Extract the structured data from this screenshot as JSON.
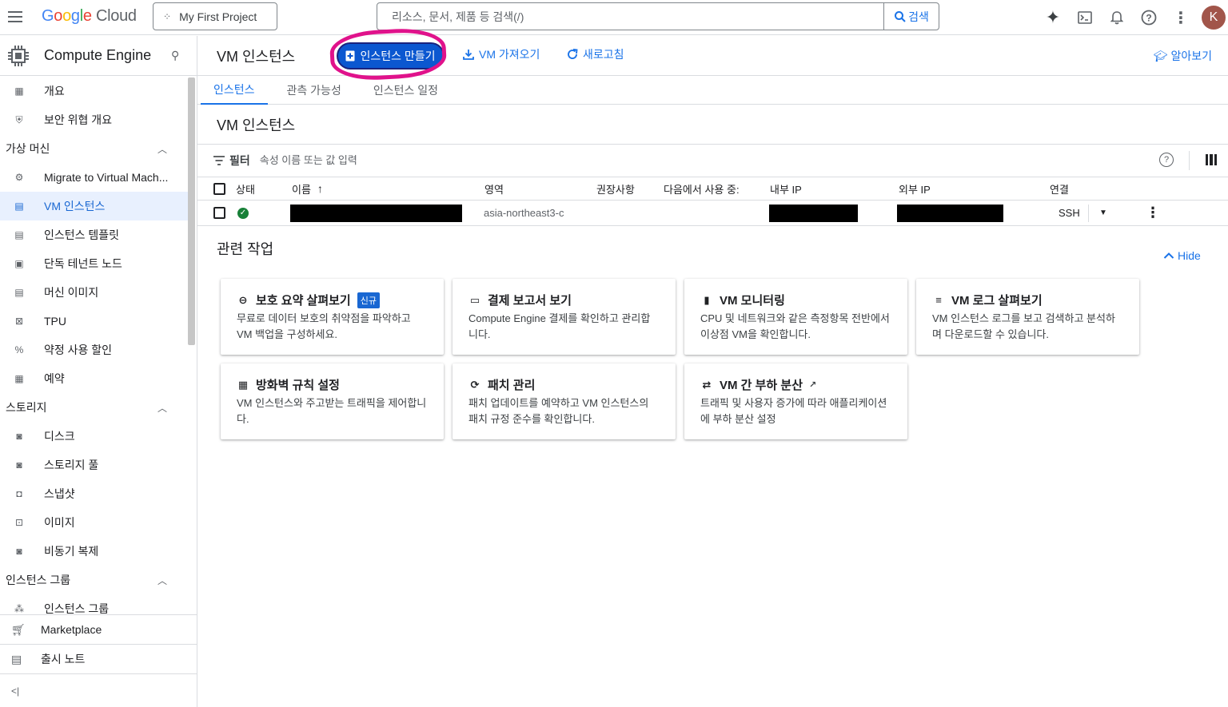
{
  "header": {
    "logo_google": "Google",
    "logo_cloud": "Cloud",
    "project": "My First Project",
    "search_placeholder": "리소스, 문서, 제품 등 검색(/)",
    "search_button": "검색",
    "avatar_letter": "K"
  },
  "sidebar": {
    "product_title": "Compute Engine",
    "items": [
      {
        "label": "개요",
        "icon": "dashboard-icon"
      },
      {
        "label": "보안 위협 개요",
        "icon": "shield-icon"
      }
    ],
    "section_vm": "가상 머신",
    "vm_items": [
      {
        "label": "Migrate to Virtual Mach...",
        "icon": "migrate-icon"
      },
      {
        "label": "VM 인스턴스",
        "icon": "vm-icon",
        "active": true
      },
      {
        "label": "인스턴스 템플릿",
        "icon": "template-icon"
      },
      {
        "label": "단독 테넌트 노드",
        "icon": "node-icon"
      },
      {
        "label": "머신 이미지",
        "icon": "machine-image-icon"
      },
      {
        "label": "TPU",
        "icon": "tpu-icon"
      },
      {
        "label": "약정 사용 할인",
        "icon": "percent-icon"
      },
      {
        "label": "예약",
        "icon": "calendar-icon"
      }
    ],
    "section_storage": "스토리지",
    "storage_items": [
      {
        "label": "디스크",
        "icon": "disk-icon"
      },
      {
        "label": "스토리지 풀",
        "icon": "storage-pool-icon"
      },
      {
        "label": "스냅샷",
        "icon": "snapshot-icon"
      },
      {
        "label": "이미지",
        "icon": "image-icon"
      },
      {
        "label": "비동기 복제",
        "icon": "replication-icon"
      }
    ],
    "section_groups": "인스턴스 그룹",
    "group_items": [
      {
        "label": "인스턴스 그룹",
        "icon": "group-icon"
      }
    ],
    "marketplace": "Marketplace",
    "release_notes": "출시 노트",
    "collapse": "<|"
  },
  "toolbar": {
    "title": "VM 인스턴스",
    "create": "인스턴스 만들기",
    "import": "VM 가져오기",
    "refresh": "새로고침",
    "learn": "알아보기"
  },
  "tabs": [
    "인스턴스",
    "관측 가능성",
    "인스턴스 일정"
  ],
  "section_title": "VM 인스턴스",
  "filter": {
    "label": "필터",
    "placeholder": "속성 이름 또는 값 입력"
  },
  "table": {
    "headers": {
      "status": "상태",
      "name": "이름",
      "zone": "영역",
      "recommend": "권장사항",
      "used_by": "다음에서 사용 중:",
      "internal_ip": "내부 IP",
      "external_ip": "외부 IP",
      "connect": "연결"
    },
    "rows": [
      {
        "zone": "asia-northeast3-c",
        "connect": "SSH",
        "status": "running"
      }
    ]
  },
  "related": {
    "title": "관련 작업",
    "hide": "Hide",
    "cards": [
      {
        "title": "보호 요약 살펴보기",
        "badge": "신규",
        "desc": "무료로 데이터 보호의 취약점을 파악하고 VM 백업을 구성하세요.",
        "icon": "backup-icon"
      },
      {
        "title": "결제 보고서 보기",
        "desc": "Compute Engine 결제를 확인하고 관리합니다.",
        "icon": "billing-icon"
      },
      {
        "title": "VM 모니터링",
        "desc": "CPU 및 네트워크와 같은 측정항목 전반에서 이상점 VM을 확인합니다.",
        "icon": "bar-chart-icon"
      },
      {
        "title": "VM 로그 살펴보기",
        "desc": "VM 인스턴스 로그를 보고 검색하고 분석하며 다운로드할 수 있습니다.",
        "icon": "logs-icon"
      },
      {
        "title": "방화벽 규칙 설정",
        "desc": "VM 인스턴스와 주고받는 트래픽을 제어합니다.",
        "icon": "firewall-icon"
      },
      {
        "title": "패치 관리",
        "desc": "패치 업데이트를 예약하고 VM 인스턴스의 패치 규정 준수를 확인합니다.",
        "icon": "patch-icon"
      },
      {
        "title": "VM 간 부하 분산",
        "desc": "트래픽 및 사용자 증가에 따라 애플리케이션에 부하 분산 설정",
        "icon": "load-balance-icon",
        "external": true
      }
    ]
  }
}
